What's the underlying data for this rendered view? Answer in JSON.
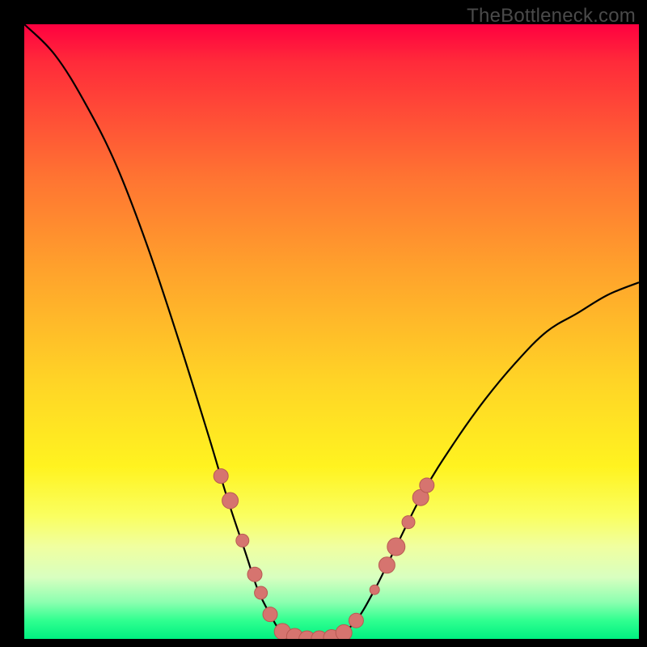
{
  "watermark": "TheBottleneck.com",
  "colors": {
    "frame": "#000000",
    "curve_stroke": "#000000",
    "marker_fill": "#d6746f",
    "marker_stroke": "#b85a52"
  },
  "chart_data": {
    "type": "line",
    "title": "",
    "xlabel": "",
    "ylabel": "",
    "xlim": [
      0,
      100
    ],
    "ylim": [
      0,
      100
    ],
    "curve_note": "V-shaped bottleneck curve; y≈100 at x≈0, dips to y≈0 around x≈42–52, rises to y≈58 at x≈100. x is relative component performance, y is estimated bottleneck percentage (higher = worse).",
    "curve_sampled": [
      {
        "x": 0,
        "y": 100
      },
      {
        "x": 5,
        "y": 95
      },
      {
        "x": 10,
        "y": 87
      },
      {
        "x": 15,
        "y": 77
      },
      {
        "x": 20,
        "y": 64
      },
      {
        "x": 25,
        "y": 49
      },
      {
        "x": 30,
        "y": 33
      },
      {
        "x": 33,
        "y": 23
      },
      {
        "x": 36,
        "y": 14
      },
      {
        "x": 38,
        "y": 8
      },
      {
        "x": 40,
        "y": 4
      },
      {
        "x": 42,
        "y": 1
      },
      {
        "x": 45,
        "y": 0
      },
      {
        "x": 48,
        "y": 0
      },
      {
        "x": 51,
        "y": 0.5
      },
      {
        "x": 54,
        "y": 3
      },
      {
        "x": 57,
        "y": 8
      },
      {
        "x": 60,
        "y": 14
      },
      {
        "x": 65,
        "y": 24
      },
      {
        "x": 70,
        "y": 32
      },
      {
        "x": 75,
        "y": 39
      },
      {
        "x": 80,
        "y": 45
      },
      {
        "x": 85,
        "y": 50
      },
      {
        "x": 90,
        "y": 53
      },
      {
        "x": 95,
        "y": 56
      },
      {
        "x": 100,
        "y": 58
      }
    ],
    "markers_note": "Salmon circular markers clustered on the two arms near the valley; sizes vary slightly (px radius in 760×760 plot).",
    "markers": [
      {
        "x": 32.0,
        "y": 26.5,
        "r": 9
      },
      {
        "x": 33.5,
        "y": 22.5,
        "r": 10
      },
      {
        "x": 35.5,
        "y": 16.0,
        "r": 8
      },
      {
        "x": 37.5,
        "y": 10.5,
        "r": 9
      },
      {
        "x": 38.5,
        "y": 7.5,
        "r": 8
      },
      {
        "x": 40.0,
        "y": 4.0,
        "r": 9
      },
      {
        "x": 42.0,
        "y": 1.2,
        "r": 10
      },
      {
        "x": 44.0,
        "y": 0.4,
        "r": 10
      },
      {
        "x": 46.0,
        "y": 0.0,
        "r": 10
      },
      {
        "x": 48.0,
        "y": 0.0,
        "r": 10
      },
      {
        "x": 50.0,
        "y": 0.2,
        "r": 10
      },
      {
        "x": 52.0,
        "y": 1.0,
        "r": 10
      },
      {
        "x": 54.0,
        "y": 3.0,
        "r": 9
      },
      {
        "x": 57.0,
        "y": 8.0,
        "r": 6
      },
      {
        "x": 59.0,
        "y": 12.0,
        "r": 10
      },
      {
        "x": 60.5,
        "y": 15.0,
        "r": 11
      },
      {
        "x": 62.5,
        "y": 19.0,
        "r": 8
      },
      {
        "x": 64.5,
        "y": 23.0,
        "r": 10
      },
      {
        "x": 65.5,
        "y": 25.0,
        "r": 9
      }
    ]
  }
}
